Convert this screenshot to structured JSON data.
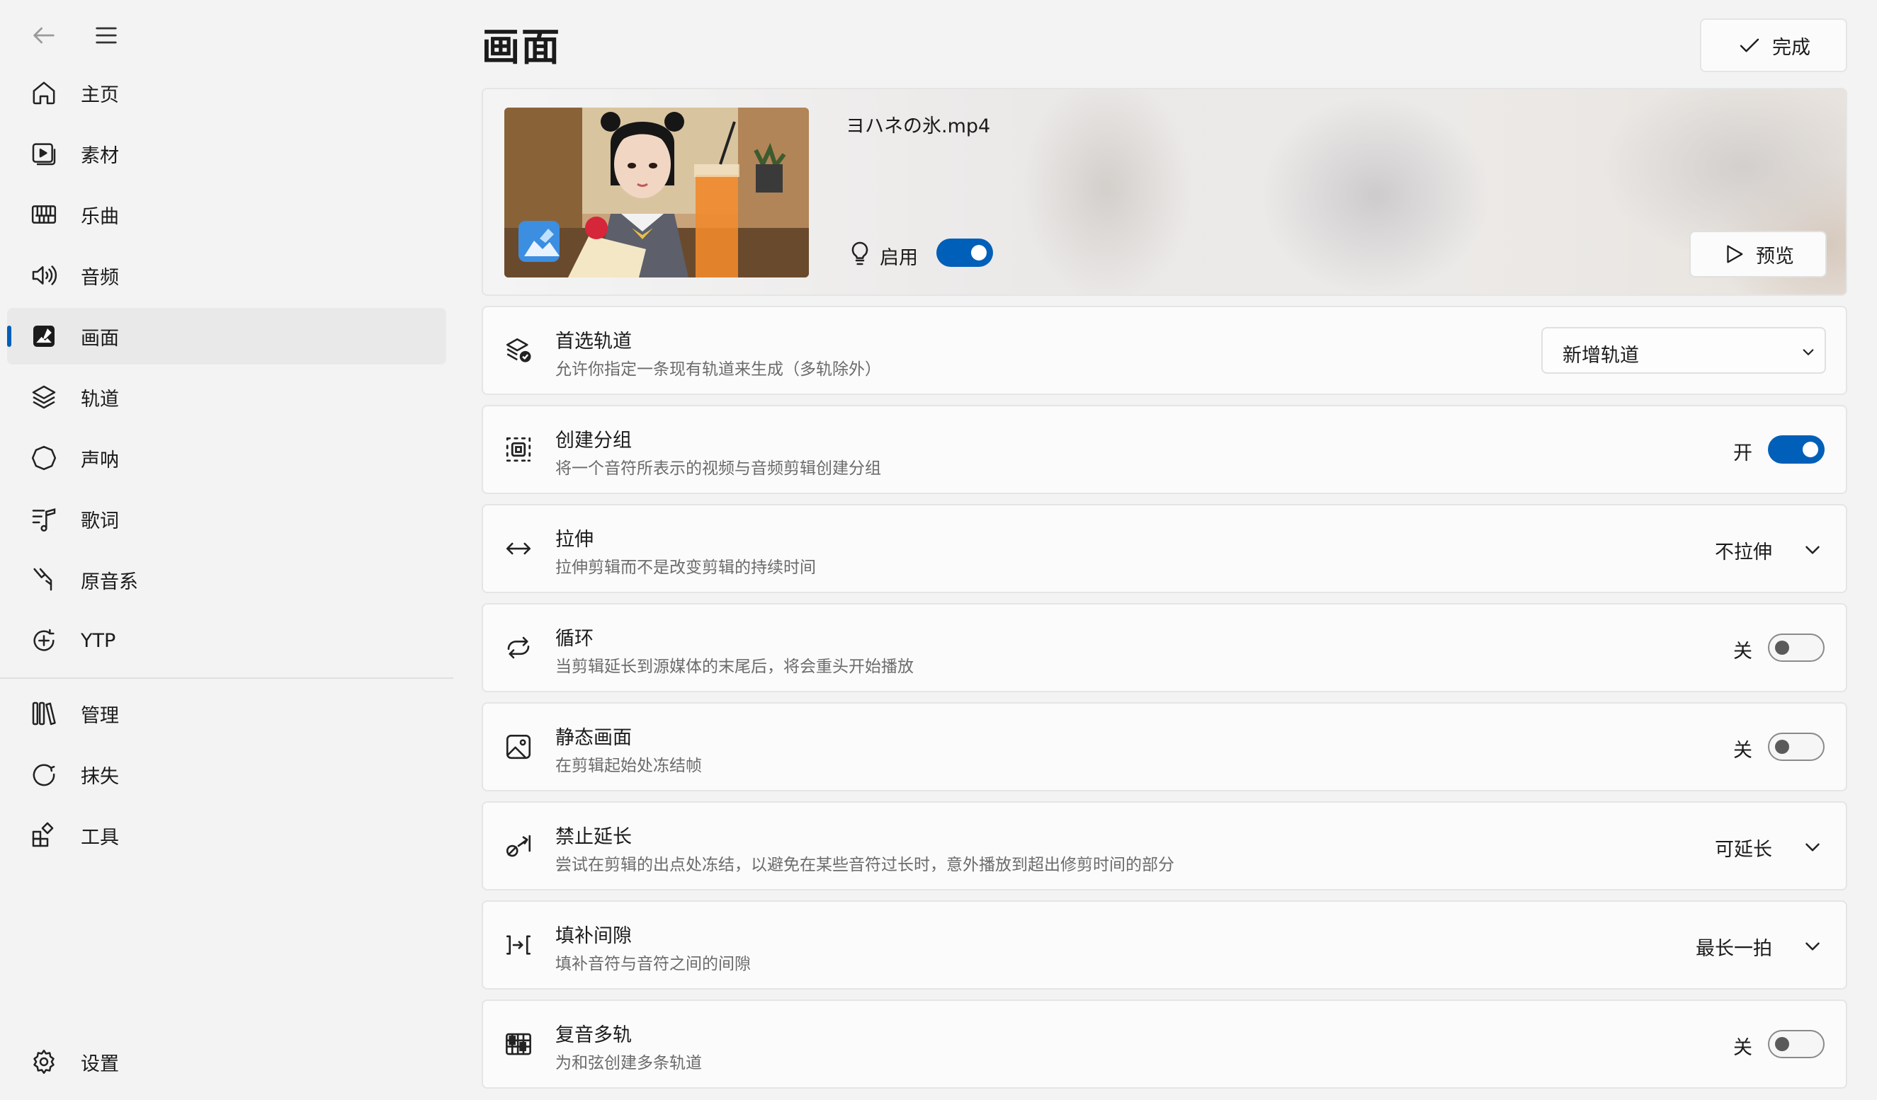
{
  "sidebar": {
    "items": [
      {
        "label": "主页",
        "icon": "home-icon"
      },
      {
        "label": "素材",
        "icon": "media-icon"
      },
      {
        "label": "乐曲",
        "icon": "piano-icon"
      },
      {
        "label": "音频",
        "icon": "speaker-icon"
      },
      {
        "label": "画面",
        "icon": "image-edit-icon",
        "active": true
      },
      {
        "label": "轨道",
        "icon": "layers-icon"
      },
      {
        "label": "声呐",
        "icon": "sonar-icon"
      },
      {
        "label": "歌词",
        "icon": "lyrics-icon"
      },
      {
        "label": "原音系",
        "icon": "tuning-fork-icon"
      },
      {
        "label": "YTP",
        "icon": "ytp-icon"
      },
      {
        "label": "管理",
        "icon": "library-icon"
      },
      {
        "label": "抹失",
        "icon": "erase-icon"
      },
      {
        "label": "工具",
        "icon": "toolbox-icon"
      }
    ],
    "settings_label": "设置"
  },
  "header": {
    "title": "画面",
    "done_label": "完成"
  },
  "media": {
    "filename": "ヨハネの氷.mp4",
    "enable_label": "启用",
    "enabled": true,
    "preview_label": "预览"
  },
  "settings": {
    "preferred_track": {
      "title": "首选轨道",
      "desc": "允许你指定一条现有轨道来生成（多轨除外）",
      "value": "新增轨道"
    },
    "create_group": {
      "title": "创建分组",
      "desc": "将一个音符所表示的视频与音频剪辑创建分组",
      "state": "开",
      "on": true
    },
    "stretch": {
      "title": "拉伸",
      "desc": "拉伸剪辑而不是改变剪辑的持续时间",
      "value": "不拉伸"
    },
    "loop": {
      "title": "循环",
      "desc": "当剪辑延长到源媒体的末尾后，将会重头开始播放",
      "state": "关",
      "on": false
    },
    "still_image": {
      "title": "静态画面",
      "desc": "在剪辑起始处冻结帧",
      "state": "关",
      "on": false
    },
    "no_extend": {
      "title": "禁止延长",
      "desc": "尝试在剪辑的出点处冻结，以避免在某些音符过长时，意外播放到超出修剪时间的部分",
      "value": "可延长"
    },
    "fill_gap": {
      "title": "填补间隙",
      "desc": "填补音符与音符之间的间隙",
      "value": "最长一拍"
    },
    "polyphony": {
      "title": "复音多轨",
      "desc": "为和弦创建多条轨道",
      "state": "关",
      "on": false
    }
  },
  "colors": {
    "accent": "#005fb8",
    "background": "#f3f3f3",
    "card": "#fbfbfb"
  }
}
